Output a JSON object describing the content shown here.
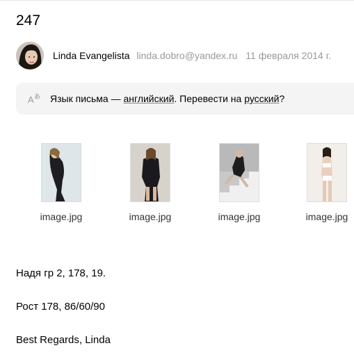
{
  "message": {
    "subject": "247",
    "sender_name": "Linda Evangelista",
    "sender_email": "linda.dobro@yandex.ru",
    "date": "11 февраля 2014 г."
  },
  "translate": {
    "icon": "translate-icon",
    "prefix": "Язык письма — ",
    "language_link": "английский",
    "middle": ". Перевести на ",
    "target_link": "русский",
    "suffix": "?"
  },
  "attachments": [
    {
      "name": "image.jpg",
      "thumb_bg": "#e9eef2"
    },
    {
      "name": "image.jpg",
      "thumb_bg": "#d8d2cc"
    },
    {
      "name": "image.jpg",
      "thumb_bg": "#cfcfcf"
    },
    {
      "name": "image.jpg",
      "thumb_bg": "#f2eeea"
    }
  ],
  "body": {
    "line1": "Надя гр 2, 178, 19.",
    "line2": "Рост 178, 86/60/90",
    "line3": "Best Regards, Linda"
  },
  "colors": {
    "meta_gray": "#999999",
    "bar_bg": "#f4f4f4"
  }
}
